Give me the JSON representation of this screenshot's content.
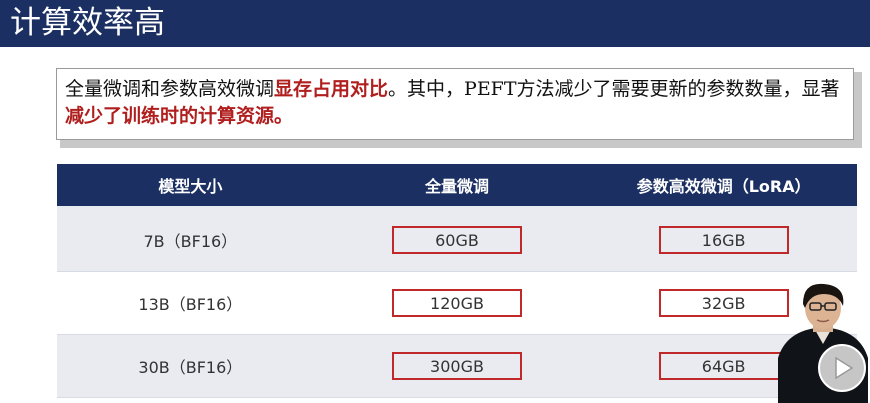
{
  "header": {
    "title": "计算效率高"
  },
  "note": {
    "part1": "全量微调和参数高效微调",
    "highlight1": "显存占用对比",
    "part2": "。其中，PEFT方法减少了需要更新的参数数量，显著",
    "highlight2": "减少了训练时的计算资源。"
  },
  "table": {
    "headers": [
      "模型大小",
      "全量微调",
      "参数高效微调（LoRA）"
    ],
    "rows": [
      {
        "model": "7B（BF16）",
        "full": "60GB",
        "lora": "16GB"
      },
      {
        "model": "13B（BF16）",
        "full": "120GB",
        "lora": "32GB"
      },
      {
        "model": "30B（BF16）",
        "full": "300GB",
        "lora": "64GB"
      }
    ]
  },
  "colors": {
    "navy": "#1b2f63",
    "highlight_red": "#b01e1e",
    "box_red": "#c0282a"
  },
  "icons": {
    "play": "play-icon",
    "presenter": "presenter-video"
  }
}
